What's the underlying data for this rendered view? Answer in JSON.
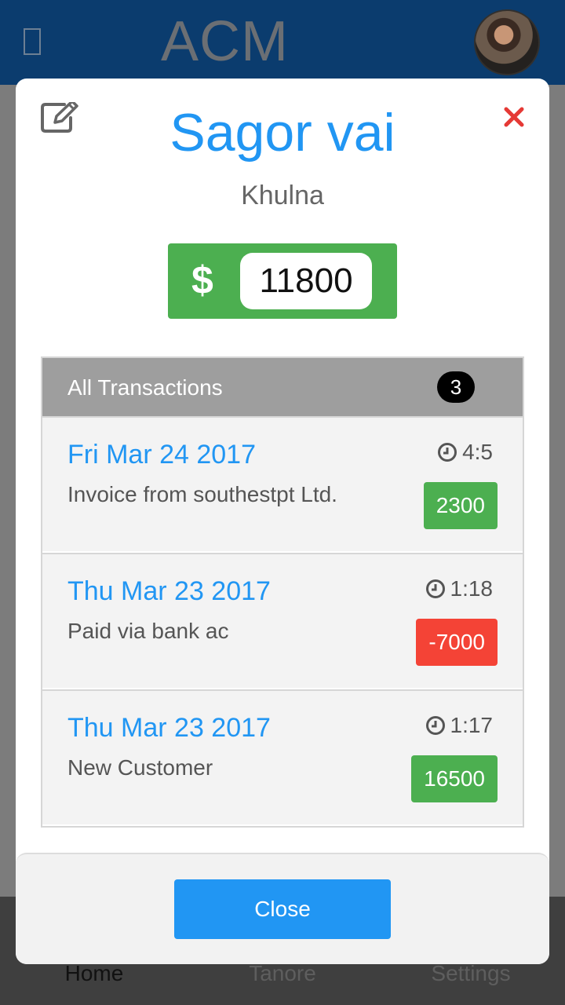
{
  "app": {
    "title": "ACM",
    "colors": {
      "header": "#0b3c6e",
      "primary": "#2196f3",
      "success": "#4caf50",
      "danger": "#f44336"
    }
  },
  "tabs": [
    {
      "label": "Home",
      "active": true
    },
    {
      "label": "Tanore",
      "active": false
    },
    {
      "label": "Settings",
      "active": false
    }
  ],
  "modal": {
    "icons": {
      "edit": "edit-icon",
      "close": "close-icon",
      "time": "clock-icon"
    },
    "customer_name": "Sagor vai",
    "customer_city": "Khulna",
    "balance": {
      "currency_symbol": "$",
      "amount": "11800"
    },
    "transactions": {
      "title": "All Transactions",
      "count": "3",
      "items": [
        {
          "date": "Fri Mar 24 2017",
          "description": "Invoice from southestpt Ltd.",
          "time": "4:5",
          "amount": "2300",
          "type": "positive"
        },
        {
          "date": "Thu Mar 23 2017",
          "description": "Paid via bank ac",
          "time": "1:18",
          "amount": "-7000",
          "type": "negative"
        },
        {
          "date": "Thu Mar 23 2017",
          "description": "New Customer",
          "time": "1:17",
          "amount": "16500",
          "type": "positive"
        }
      ]
    },
    "close_label": "Close"
  }
}
